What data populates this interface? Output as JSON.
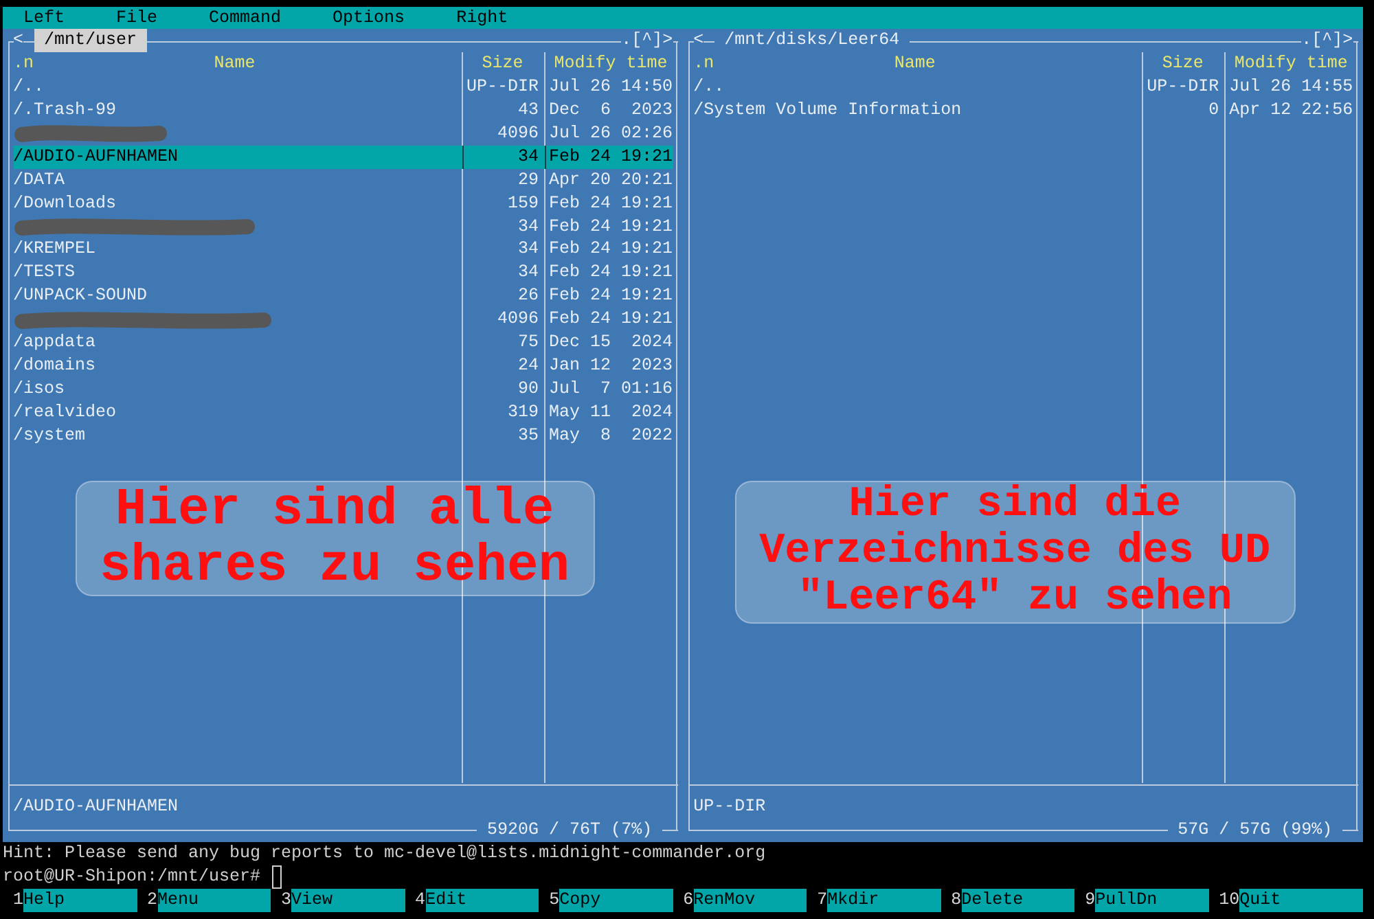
{
  "menu": [
    "Left",
    "File",
    "Command",
    "Options",
    "Right"
  ],
  "panels": [
    {
      "active": true,
      "nav_left": "<",
      "path": "/mnt/user",
      "nav_right": ".[^]>",
      "columns": {
        "sort": ".n",
        "name": "Name",
        "size": "Size",
        "modified": "Modify time"
      },
      "files": [
        {
          "name": "/..",
          "size": "UP--DIR",
          "modified": "Jul 26 14:50",
          "redacted": false,
          "selected": false
        },
        {
          "name": "/.Trash-99",
          "size": "43",
          "modified": "Dec  6  2023",
          "redacted": false,
          "selected": false
        },
        {
          "size": "4096",
          "modified": "Jul 26 02:26",
          "redacted": true,
          "selected": false
        },
        {
          "name": "/AUDIO-AUFNHAMEN",
          "size": "34",
          "modified": "Feb 24 19:21",
          "redacted": false,
          "selected": true
        },
        {
          "name": "/DATA",
          "size": "29",
          "modified": "Apr 20 20:21",
          "redacted": false,
          "selected": false
        },
        {
          "name": "/Downloads",
          "size": "159",
          "modified": "Feb 24 19:21",
          "redacted": false,
          "selected": false
        },
        {
          "size": "34",
          "modified": "Feb 24 19:21",
          "redacted": true,
          "selected": false
        },
        {
          "name": "/KREMPEL",
          "size": "34",
          "modified": "Feb 24 19:21",
          "redacted": false,
          "selected": false
        },
        {
          "name": "/TESTS",
          "size": "34",
          "modified": "Feb 24 19:21",
          "redacted": false,
          "selected": false
        },
        {
          "name": "/UNPACK-SOUND",
          "size": "26",
          "modified": "Feb 24 19:21",
          "redacted": false,
          "selected": false
        },
        {
          "size": "4096",
          "modified": "Feb 24 19:21",
          "redacted": true,
          "selected": false
        },
        {
          "name": "/appdata",
          "size": "75",
          "modified": "Dec 15  2024",
          "redacted": false,
          "selected": false
        },
        {
          "name": "/domains",
          "size": "24",
          "modified": "Jan 12  2023",
          "redacted": false,
          "selected": false
        },
        {
          "name": "/isos",
          "size": "90",
          "modified": "Jul  7 01:16",
          "redacted": false,
          "selected": false
        },
        {
          "name": "/realvideo",
          "size": "319",
          "modified": "May 11  2024",
          "redacted": false,
          "selected": false
        },
        {
          "name": "/system",
          "size": "35",
          "modified": "May  8  2022",
          "redacted": false,
          "selected": false
        }
      ],
      "annotation": "Hier sind alle\nshares zu sehen",
      "mini_status": "/AUDIO-AUFNHAMEN",
      "disk_info": "5920G / 76T (7%)"
    },
    {
      "active": false,
      "nav_left": "<",
      "path": "/mnt/disks/Leer64",
      "nav_right": ".[^]>",
      "columns": {
        "sort": ".n",
        "name": "Name",
        "size": "Size",
        "modified": "Modify time"
      },
      "files": [
        {
          "name": "/..",
          "size": "UP--DIR",
          "modified": "Jul 26 14:55",
          "redacted": false,
          "selected": false
        },
        {
          "name": "/System Volume Information",
          "size": "0",
          "modified": "Apr 12 22:56",
          "redacted": false,
          "selected": false
        }
      ],
      "annotation": "Hier sind die\nVerzeichnisse des UD\n\"Leer64\" zu sehen",
      "mini_status": "UP--DIR",
      "disk_info": "57G / 57G (99%)"
    }
  ],
  "hint": "Hint: Please send any bug reports to mc-devel@lists.midnight-commander.org",
  "prompt": "root@UR-Shipon:/mnt/user#",
  "function_keys": [
    {
      "key": "1",
      "label": "Help"
    },
    {
      "key": "2",
      "label": "Menu"
    },
    {
      "key": "3",
      "label": "View"
    },
    {
      "key": "4",
      "label": "Edit"
    },
    {
      "key": "5",
      "label": "Copy"
    },
    {
      "key": "6",
      "label": "RenMov"
    },
    {
      "key": "7",
      "label": "Mkdir"
    },
    {
      "key": "8",
      "label": "Delete"
    },
    {
      "key": "9",
      "label": "PullDn"
    },
    {
      "key": "10",
      "label": "Quit"
    }
  ]
}
